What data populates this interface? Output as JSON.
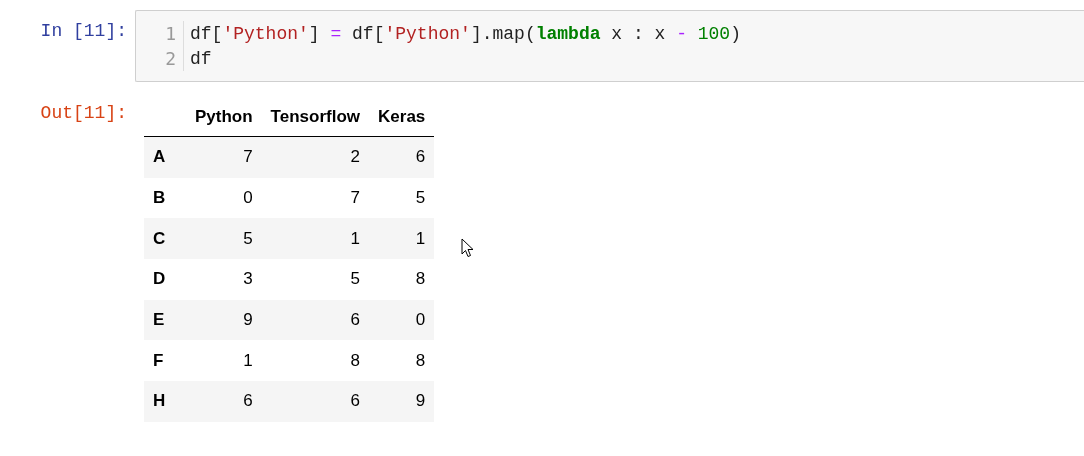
{
  "input_cell": {
    "prompt": "In  [11]:",
    "lines": [
      {
        "number": "1",
        "tokens": [
          {
            "kind": "plain",
            "text": "df["
          },
          {
            "kind": "string",
            "text": "'Python'"
          },
          {
            "kind": "plain",
            "text": "] "
          },
          {
            "kind": "operator",
            "text": "="
          },
          {
            "kind": "plain",
            "text": " df["
          },
          {
            "kind": "string",
            "text": "'Python'"
          },
          {
            "kind": "plain",
            "text": "].map("
          },
          {
            "kind": "keyword",
            "text": "lambda"
          },
          {
            "kind": "plain",
            "text": " x : x "
          },
          {
            "kind": "operator",
            "text": "- "
          },
          {
            "kind": "number",
            "text": "100"
          },
          {
            "kind": "plain",
            "text": ")"
          }
        ]
      },
      {
        "number": "2",
        "tokens": [
          {
            "kind": "plain",
            "text": "df"
          }
        ]
      }
    ]
  },
  "output_cell": {
    "prompt": "Out[11]:",
    "table": {
      "columns": [
        "Python",
        "Tensorflow",
        "Keras"
      ],
      "rows": [
        {
          "index": "A",
          "values": [
            "7",
            "2",
            "6"
          ]
        },
        {
          "index": "B",
          "values": [
            "0",
            "7",
            "5"
          ]
        },
        {
          "index": "C",
          "values": [
            "5",
            "1",
            "1"
          ]
        },
        {
          "index": "D",
          "values": [
            "3",
            "5",
            "8"
          ]
        },
        {
          "index": "E",
          "values": [
            "9",
            "6",
            "0"
          ]
        },
        {
          "index": "F",
          "values": [
            "1",
            "8",
            "8"
          ]
        },
        {
          "index": "H",
          "values": [
            "6",
            "6",
            "9"
          ]
        }
      ]
    }
  }
}
